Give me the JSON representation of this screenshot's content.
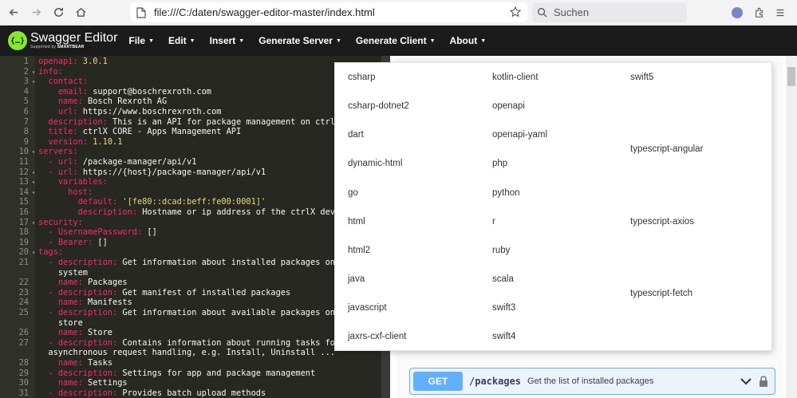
{
  "browser": {
    "url": "file:///C:/daten/swagger-editor-master/index.html",
    "search_placeholder": "Suchen"
  },
  "swagger": {
    "logo_title": "Swagger Editor",
    "logo_supported_by": "Supported by",
    "logo_brand": "SMARTBEAR",
    "menu": [
      {
        "label": "File"
      },
      {
        "label": "Edit"
      },
      {
        "label": "Insert"
      },
      {
        "label": "Generate Server"
      },
      {
        "label": "Generate Client"
      },
      {
        "label": "About"
      }
    ]
  },
  "editor_lines": [
    {
      "n": "1",
      "fold": "",
      "indent": "",
      "key": "openapi:",
      "val": " 3.0.1"
    },
    {
      "n": "2",
      "fold": "▾",
      "indent": "",
      "key": "info:",
      "val": ""
    },
    {
      "n": "3",
      "fold": "▾",
      "indent": "  ",
      "key": "contact:",
      "val": ""
    },
    {
      "n": "4",
      "fold": "",
      "indent": "    ",
      "key": "email:",
      "val": " support@boschrexroth.com",
      "plain": true
    },
    {
      "n": "5",
      "fold": "",
      "indent": "    ",
      "key": "name:",
      "val": " Bosch Rexroth AG",
      "plain": true
    },
    {
      "n": "6",
      "fold": "",
      "indent": "    ",
      "key": "url:",
      "val": " https://www.boschrexroth.com",
      "plain": true
    },
    {
      "n": "7",
      "fold": "",
      "indent": "  ",
      "key": "description:",
      "val": " This is an API for package management on ctrlX",
      "plain": true
    },
    {
      "n": "8",
      "fold": "",
      "indent": "  ",
      "key": "title:",
      "val": " ctrlX CORE - Apps Management API",
      "plain": true
    },
    {
      "n": "9",
      "fold": "",
      "indent": "  ",
      "key": "version:",
      "val": " 1.10.1"
    },
    {
      "n": "10",
      "fold": "▾",
      "indent": "",
      "key": "servers:",
      "val": ""
    },
    {
      "n": "11",
      "fold": "",
      "indent": "  - ",
      "key": "url:",
      "val": " /package-manager/api/v1",
      "plain": true
    },
    {
      "n": "12",
      "fold": "▾",
      "indent": "  - ",
      "key": "url:",
      "val": " https://{host}/package-manager/api/v1",
      "plain": true
    },
    {
      "n": "13",
      "fold": "▾",
      "indent": "    ",
      "key": "variables:",
      "val": ""
    },
    {
      "n": "14",
      "fold": "▾",
      "indent": "      ",
      "key": "host:",
      "val": ""
    },
    {
      "n": "15",
      "fold": "",
      "indent": "        ",
      "key": "default:",
      "val": " '[fe80::dcad:beff:fe00:0001]'"
    },
    {
      "n": "16",
      "fold": "",
      "indent": "        ",
      "key": "description:",
      "val": " Hostname or ip address of the ctrlX devic",
      "plain": true
    },
    {
      "n": "17",
      "fold": "▾",
      "indent": "",
      "key": "security:",
      "val": ""
    },
    {
      "n": "18",
      "fold": "",
      "indent": "  - ",
      "key": "UsernamePassword:",
      "val": " []",
      "plain": true
    },
    {
      "n": "19",
      "fold": "",
      "indent": "  - ",
      "key": "Bearer:",
      "val": " []",
      "plain": true
    },
    {
      "n": "20",
      "fold": "▾",
      "indent": "",
      "key": "tags:",
      "val": ""
    },
    {
      "n": "21",
      "fold": "",
      "indent": "  - ",
      "key": "description:",
      "val": " Get information about installed packages on t",
      "plain": true
    },
    {
      "n": "",
      "fold": "",
      "indent": "    ",
      "key": "",
      "val": "system",
      "plain": true
    },
    {
      "n": "22",
      "fold": "",
      "indent": "    ",
      "key": "name:",
      "val": " Packages",
      "plain": true
    },
    {
      "n": "23",
      "fold": "",
      "indent": "  - ",
      "key": "description:",
      "val": " Get manifest of installed packages",
      "plain": true
    },
    {
      "n": "24",
      "fold": "",
      "indent": "    ",
      "key": "name:",
      "val": " Manifests",
      "plain": true
    },
    {
      "n": "25",
      "fold": "",
      "indent": "  - ",
      "key": "description:",
      "val": " Get information about available packages on t",
      "plain": true
    },
    {
      "n": "",
      "fold": "",
      "indent": "    ",
      "key": "",
      "val": "store",
      "plain": true
    },
    {
      "n": "26",
      "fold": "",
      "indent": "    ",
      "key": "name:",
      "val": " Store",
      "plain": true
    },
    {
      "n": "27",
      "fold": "",
      "indent": "  - ",
      "key": "description:",
      "val": " Contains information about running tasks for",
      "plain": true
    },
    {
      "n": "",
      "fold": "",
      "indent": "  ",
      "key": "",
      "val": "asynchronous request handling, e.g. Install, Uninstall ...",
      "plain": true
    },
    {
      "n": "28",
      "fold": "",
      "indent": "    ",
      "key": "name:",
      "val": " Tasks",
      "plain": true
    },
    {
      "n": "29",
      "fold": "",
      "indent": "  - ",
      "key": "description:",
      "val": " Settings for app and package management",
      "plain": true
    },
    {
      "n": "30",
      "fold": "",
      "indent": "    ",
      "key": "name:",
      "val": " Settings",
      "plain": true
    },
    {
      "n": "31",
      "fold": "",
      "indent": "  - ",
      "key": "description:",
      "val": " Provides batch upload methods",
      "plain": true
    }
  ],
  "client_dropdown": {
    "col1": [
      "csharp",
      "csharp-dotnet2",
      "dart",
      "dynamic-html",
      "go",
      "html",
      "html2",
      "java",
      "javascript",
      "jaxrs-cxf-client"
    ],
    "col2": [
      "kotlin-client",
      "openapi",
      "openapi-yaml",
      "php",
      "python",
      "r",
      "ruby",
      "scala",
      "swift3",
      "swift4"
    ],
    "col3": [
      "swift5",
      "typescript-angular",
      "typescript-axios",
      "typescript-fetch"
    ]
  },
  "operation": {
    "method": "GET",
    "path": "/packages",
    "summary": "Get the list of installed packages"
  }
}
